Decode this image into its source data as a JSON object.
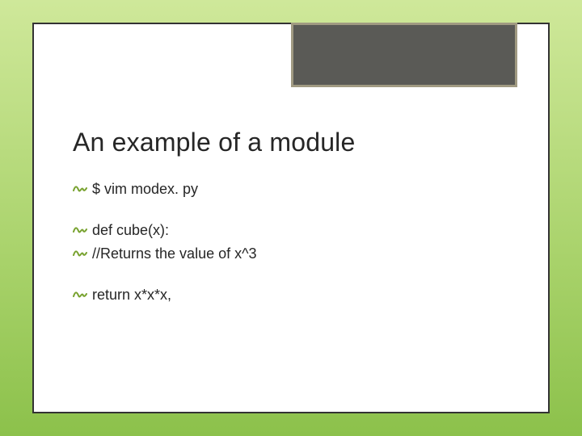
{
  "title": "An example of a module",
  "lines": {
    "l1": "$  vim   modex. py",
    "l2": "def cube(x):",
    "l3": "//Returns the value of x^3",
    "l4": "return x*x*x,"
  },
  "icon_name": "squiggle-bullet-icon",
  "accent_color": "#78a22f"
}
